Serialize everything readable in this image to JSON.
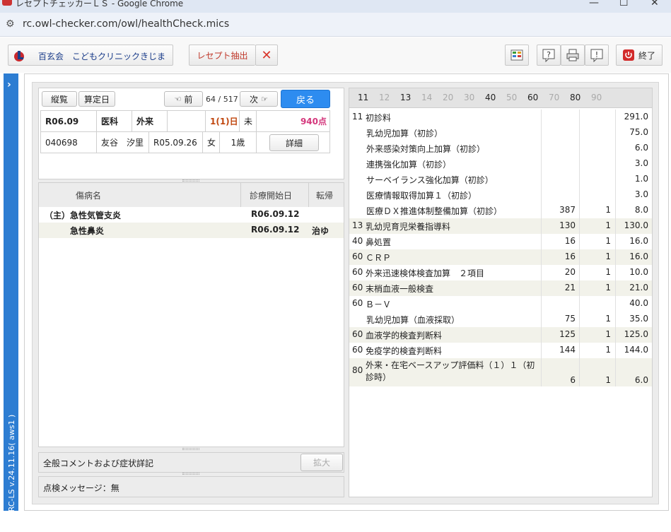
{
  "browser": {
    "title": "レセプトチェッカーＬＳ - Google Chrome",
    "url": "rc.owl-checker.com/owl/healthCheck.mics"
  },
  "toolbar": {
    "clinic_label": "百玄会　こどもクリニックきじま",
    "extract_label": "レセプト抽出",
    "exit_label": "終了"
  },
  "sidebar": {
    "version": "RC-LS v.24.11.16( aws1 )"
  },
  "nav": {
    "list_label": "縦覧",
    "calc_label": "算定日",
    "prev_label": "前",
    "counter": "64 / 517",
    "next_label": "次",
    "back_label": "戻る"
  },
  "patient": {
    "era": "R06.09",
    "dept": "医科",
    "visit_type": "外来",
    "days": "1(1)日",
    "status": "未",
    "points": "940点",
    "id": "040698",
    "name": "友谷　汐里",
    "birth": "R05.09.26",
    "sex": "女",
    "age": "1歳",
    "detail_label": "詳細"
  },
  "disease_table": {
    "headers": {
      "name": "傷病名",
      "start": "診療開始日",
      "outcome": "転帰"
    },
    "rows": [
      {
        "prefix": "（主）",
        "name": "急性気管支炎",
        "start": "R06.09.12",
        "outcome": ""
      },
      {
        "prefix": "",
        "name": "急性鼻炎",
        "start": "R06.09.12",
        "outcome": "治ゆ"
      }
    ]
  },
  "comment": {
    "label": "全般コメントおよび症状詳記",
    "expand_label": "拡大"
  },
  "message": {
    "label": "点検メッセージ：無"
  },
  "categories": [
    {
      "code": "11",
      "active": true
    },
    {
      "code": "12",
      "active": false
    },
    {
      "code": "13",
      "active": true
    },
    {
      "code": "14",
      "active": false
    },
    {
      "code": "20",
      "active": false
    },
    {
      "code": "30",
      "active": false
    },
    {
      "code": "40",
      "active": true
    },
    {
      "code": "50",
      "active": false
    },
    {
      "code": "60",
      "active": true
    },
    {
      "code": "70",
      "active": false
    },
    {
      "code": "80",
      "active": true
    },
    {
      "code": "90",
      "active": false
    }
  ],
  "items": [
    {
      "code": "11",
      "name": "初診料",
      "unit": "",
      "count": "",
      "total": "291.0",
      "indent": false,
      "shaded": false
    },
    {
      "code": "",
      "name": "乳幼児加算（初診）",
      "unit": "",
      "count": "",
      "total": "75.0",
      "indent": true,
      "shaded": false
    },
    {
      "code": "",
      "name": "外来感染対策向上加算（初診）",
      "unit": "",
      "count": "",
      "total": "6.0",
      "indent": true,
      "shaded": false
    },
    {
      "code": "",
      "name": "連携強化加算（初診）",
      "unit": "",
      "count": "",
      "total": "3.0",
      "indent": true,
      "shaded": false
    },
    {
      "code": "",
      "name": "サーベイランス強化加算（初診）",
      "unit": "",
      "count": "",
      "total": "1.0",
      "indent": true,
      "shaded": false
    },
    {
      "code": "",
      "name": "医療情報取得加算１（初診）",
      "unit": "",
      "count": "",
      "total": "3.0",
      "indent": true,
      "shaded": false
    },
    {
      "code": "",
      "name": "医療ＤＸ推進体制整備加算（初診）",
      "unit": "387",
      "count": "1",
      "total": "8.0",
      "indent": true,
      "shaded": false
    },
    {
      "code": "13",
      "name": "乳幼児育児栄養指導料",
      "unit": "130",
      "count": "1",
      "total": "130.0",
      "indent": false,
      "shaded": true
    },
    {
      "code": "40",
      "name": "鼻処置",
      "unit": "16",
      "count": "1",
      "total": "16.0",
      "indent": false,
      "shaded": false
    },
    {
      "code": "60",
      "name": "ＣＲＰ",
      "unit": "16",
      "count": "1",
      "total": "16.0",
      "indent": false,
      "shaded": true
    },
    {
      "code": "60",
      "name": "外来迅速検体検査加算　２項目",
      "unit": "20",
      "count": "1",
      "total": "10.0",
      "indent": false,
      "shaded": false
    },
    {
      "code": "60",
      "name": "末梢血液一般検査",
      "unit": "21",
      "count": "1",
      "total": "21.0",
      "indent": false,
      "shaded": true
    },
    {
      "code": "60",
      "name": "Ｂ－Ｖ",
      "unit": "",
      "count": "",
      "total": "40.0",
      "indent": false,
      "shaded": false
    },
    {
      "code": "",
      "name": "乳幼児加算（血液採取）",
      "unit": "75",
      "count": "1",
      "total": "35.0",
      "indent": true,
      "shaded": false
    },
    {
      "code": "60",
      "name": "血液学的検査判断料",
      "unit": "125",
      "count": "1",
      "total": "125.0",
      "indent": false,
      "shaded": true
    },
    {
      "code": "60",
      "name": "免疫学的検査判断料",
      "unit": "144",
      "count": "1",
      "total": "144.0",
      "indent": false,
      "shaded": false
    },
    {
      "code": "80",
      "name": "外来・在宅ベースアップ評価料（１）１（初診時）",
      "unit": "6",
      "count": "1",
      "total": "6.0",
      "indent": false,
      "shaded": true,
      "tall": true
    }
  ],
  "colors": {
    "accent": "#2d7dd2",
    "points": "#d4377c",
    "days": "#c0470f",
    "close_x": "#d9362b"
  }
}
